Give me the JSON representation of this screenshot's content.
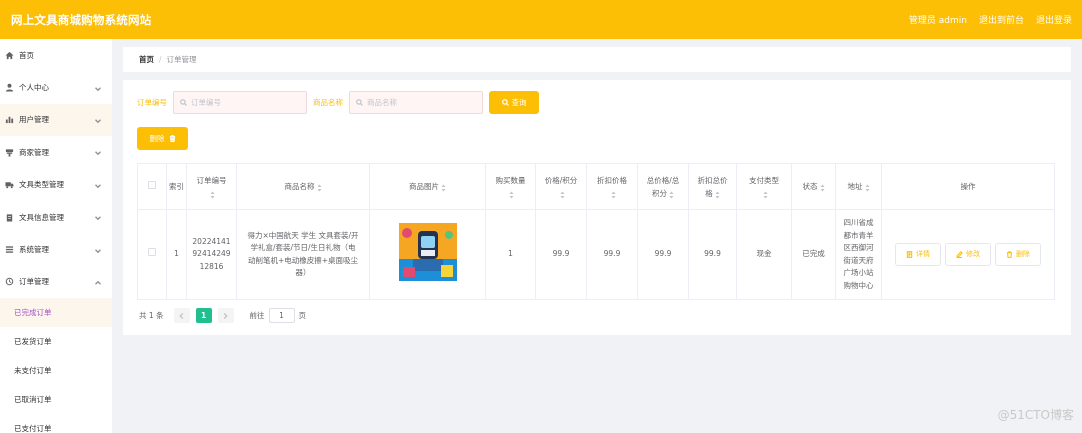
{
  "header": {
    "title": "网上文具商城购物系统网站",
    "user": "管理员 admin",
    "back_to_front": "退出到前台",
    "logout": "退出登录"
  },
  "sidebar": {
    "items": [
      {
        "label": "首页",
        "icon": "home-icon",
        "arrow": false
      },
      {
        "label": "个人中心",
        "icon": "person-icon",
        "arrow": true
      },
      {
        "label": "用户管理",
        "icon": "chart-icon",
        "arrow": true
      },
      {
        "label": "商家管理",
        "icon": "shop-icon",
        "arrow": true
      },
      {
        "label": "文具类型管理",
        "icon": "truck-icon",
        "arrow": true
      },
      {
        "label": "文具信息管理",
        "icon": "clipboard-icon",
        "arrow": true
      },
      {
        "label": "系统管理",
        "icon": "list-icon",
        "arrow": true
      },
      {
        "label": "订单管理",
        "icon": "clock-icon",
        "arrow": true
      }
    ],
    "sub_items": [
      {
        "label": "已完成订单",
        "current": true
      },
      {
        "label": "已发货订单",
        "current": false
      },
      {
        "label": "未支付订单",
        "current": false
      },
      {
        "label": "已取消订单",
        "current": false
      },
      {
        "label": "已支付订单",
        "current": false
      }
    ]
  },
  "breadcrumb": {
    "home": "首页",
    "separator": "/",
    "current": "订单管理"
  },
  "search": {
    "order_label": "订单编号",
    "order_placeholder": "订单编号",
    "product_label": "商品名称",
    "product_placeholder": "商品名称",
    "search_button": "查询"
  },
  "toolbar": {
    "delete_button": "删除"
  },
  "table": {
    "headers": [
      "索引",
      "订单编号",
      "商品名称",
      "商品图片",
      "购买数量",
      "价格/积分",
      "折扣价格",
      "总价格/总积分",
      "折扣总价格",
      "支付类型",
      "状态",
      "地址",
      "操作"
    ],
    "header_display": {
      "index": "索引",
      "order_no": "订单编号",
      "product_name": "商品名称",
      "image": "商品图片",
      "quantity_l1": "购买数量",
      "price_l1": "价格/积分",
      "discount_l1": "折扣价格",
      "total_l1": "总价格/总",
      "total_l2": "积分",
      "disc_total_l1": "折扣总价",
      "disc_total_l2": "格",
      "pay_type": "支付类型",
      "status": "状态",
      "address": "地址",
      "actions": "操作"
    },
    "rows": [
      {
        "index": "1",
        "order_no_l1": "20224141",
        "order_no_l2": "92414249",
        "order_no_l3": "12816",
        "product_name_l1": "得力×中国航天 学生 文具套装/开",
        "product_name_l2": "学礼盒/套装/节日/生日礼物（电",
        "product_name_l3": "动削笔机+电动橡皮擦+桌面吸尘",
        "product_name_l4": "器）",
        "quantity": "1",
        "price": "99.9",
        "discount_price": "99.9",
        "total": "99.9",
        "discount_total": "99.9",
        "pay_type": "现金",
        "status": "已完成",
        "address_l1": "四川省成",
        "address_l2": "都市青羊",
        "address_l3": "区西御河",
        "address_l4": "街道天府",
        "address_l5": "广场小站",
        "address_l6": "购物中心",
        "btn_detail": "详情",
        "btn_edit": "修改",
        "btn_delete": "删除"
      }
    ]
  },
  "pagination": {
    "total_text": "共 1 条",
    "current_page": "1",
    "goto_label": "前往",
    "goto_value": "1",
    "page_suffix": "页"
  },
  "watermark": "@51CTO博客",
  "colors": {
    "accent": "#fcbf06",
    "submenu_active": "#a451c8",
    "page_active": "#1fbf8f"
  }
}
